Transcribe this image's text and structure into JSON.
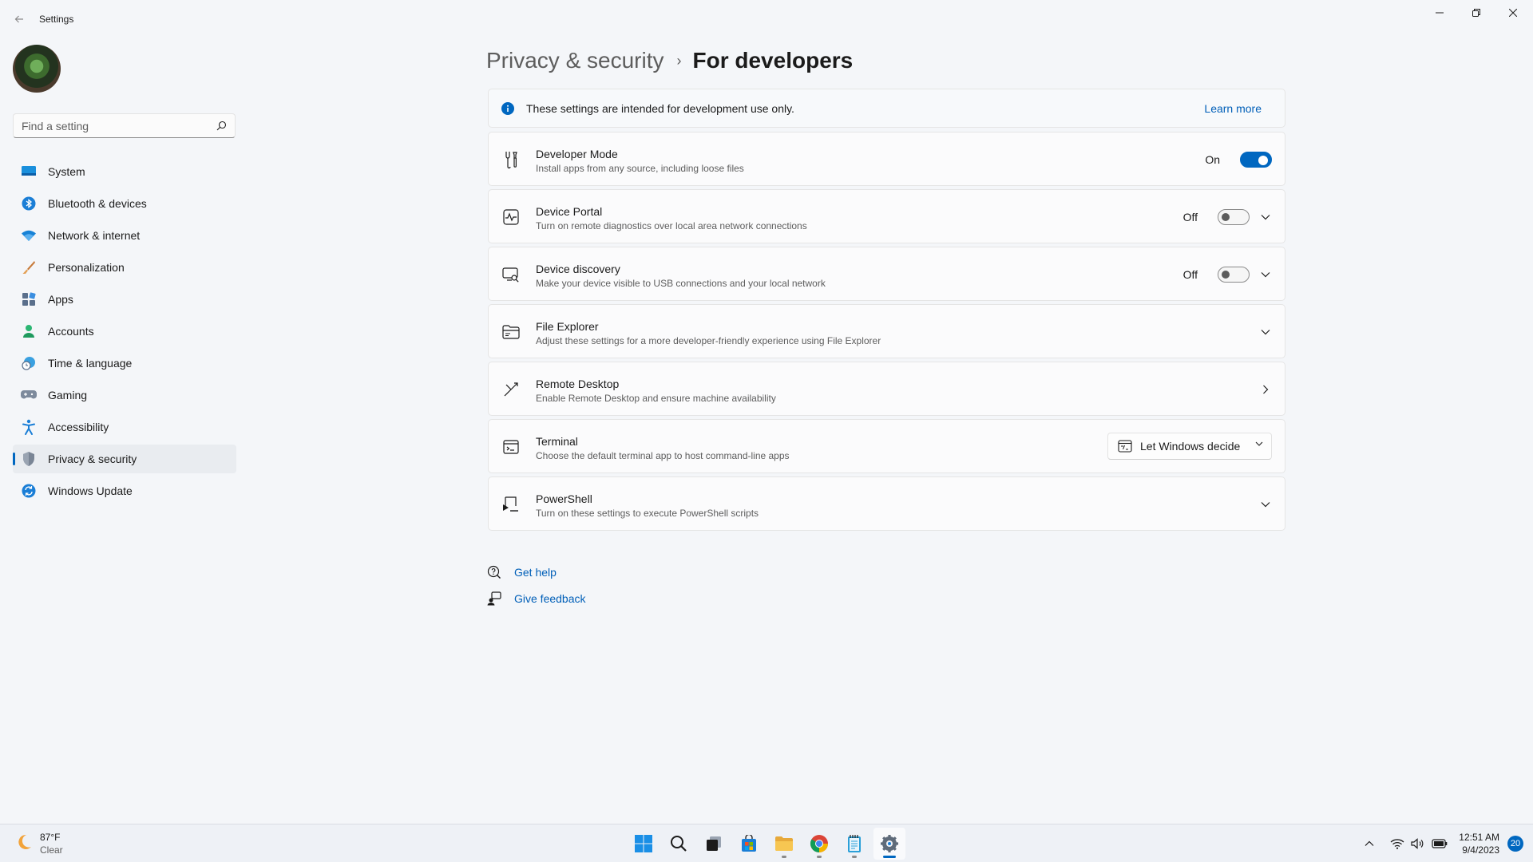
{
  "window": {
    "app_title": "Settings"
  },
  "sidebar": {
    "search_placeholder": "Find a setting",
    "items": [
      {
        "label": "System",
        "icon": "monitor-icon"
      },
      {
        "label": "Bluetooth & devices",
        "icon": "bluetooth-icon"
      },
      {
        "label": "Network & internet",
        "icon": "wifi-icon"
      },
      {
        "label": "Personalization",
        "icon": "brush-icon"
      },
      {
        "label": "Apps",
        "icon": "apps-icon"
      },
      {
        "label": "Accounts",
        "icon": "person-icon"
      },
      {
        "label": "Time & language",
        "icon": "globe-clock-icon"
      },
      {
        "label": "Gaming",
        "icon": "gamepad-icon"
      },
      {
        "label": "Accessibility",
        "icon": "accessibility-icon"
      },
      {
        "label": "Privacy & security",
        "icon": "shield-icon",
        "selected": true
      },
      {
        "label": "Windows Update",
        "icon": "update-icon"
      }
    ]
  },
  "header": {
    "parent": "Privacy & security",
    "separator": "›",
    "current": "For developers"
  },
  "info_banner": {
    "text": "These settings are intended for development use only.",
    "link": "Learn more"
  },
  "settings": {
    "developer_mode": {
      "title": "Developer Mode",
      "description": "Install apps from any source, including loose files",
      "state": "On"
    },
    "device_portal": {
      "title": "Device Portal",
      "description": "Turn on remote diagnostics over local area network connections",
      "state": "Off"
    },
    "device_discovery": {
      "title": "Device discovery",
      "description": "Make your device visible to USB connections and your local network",
      "state": "Off"
    },
    "file_explorer": {
      "title": "File Explorer",
      "description": "Adjust these settings for a more developer-friendly experience using File Explorer"
    },
    "remote_desktop": {
      "title": "Remote Desktop",
      "description": "Enable Remote Desktop and ensure machine availability"
    },
    "terminal": {
      "title": "Terminal",
      "description": "Choose the default terminal app to host command-line apps",
      "selected_value": "Let Windows decide"
    },
    "powershell": {
      "title": "PowerShell",
      "description": "Turn on these settings to execute PowerShell scripts"
    }
  },
  "footer_links": {
    "get_help": "Get help",
    "give_feedback": "Give feedback"
  },
  "taskbar": {
    "weather_temp": "87°F",
    "weather_cond": "Clear",
    "time": "12:51 AM",
    "date": "9/4/2023",
    "notification_count": "20"
  },
  "colors": {
    "accent": "#0067c0",
    "link": "#005fb8"
  }
}
